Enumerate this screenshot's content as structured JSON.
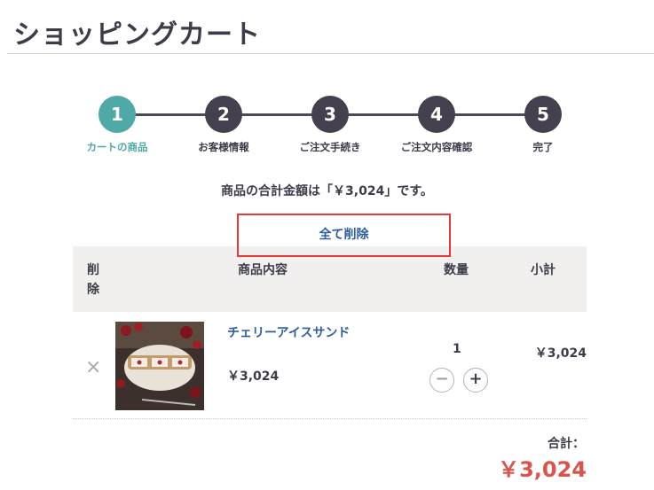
{
  "page": {
    "title": "ショッピングカート"
  },
  "steps": [
    {
      "number": "1",
      "label": "カートの商品",
      "active": true
    },
    {
      "number": "2",
      "label": "お客様情報",
      "active": false
    },
    {
      "number": "3",
      "label": "ご注文手続き",
      "active": false
    },
    {
      "number": "4",
      "label": "ご注文内容確認",
      "active": false
    },
    {
      "number": "5",
      "label": "完了",
      "active": false
    }
  ],
  "summary_message": "商品の合計金額は「￥3,024」です。",
  "delete_all_label": "全て削除",
  "table": {
    "headers": {
      "remove": "削除",
      "item": "商品内容",
      "quantity": "数量",
      "subtotal": "小計"
    },
    "rows": [
      {
        "name": "チェリーアイスサンド",
        "price": "￥3,024",
        "quantity": "1",
        "subtotal": "￥3,024",
        "remove_icon": "×"
      }
    ]
  },
  "qty_controls": {
    "minus": "−",
    "plus": "+"
  },
  "total": {
    "label": "合計：",
    "value": "￥3,024"
  },
  "colors": {
    "accent": "#4fa9a7",
    "step": "#45404e",
    "link": "#2d5f9b",
    "total": "#d9544a",
    "highlight_border": "#e53a36"
  }
}
